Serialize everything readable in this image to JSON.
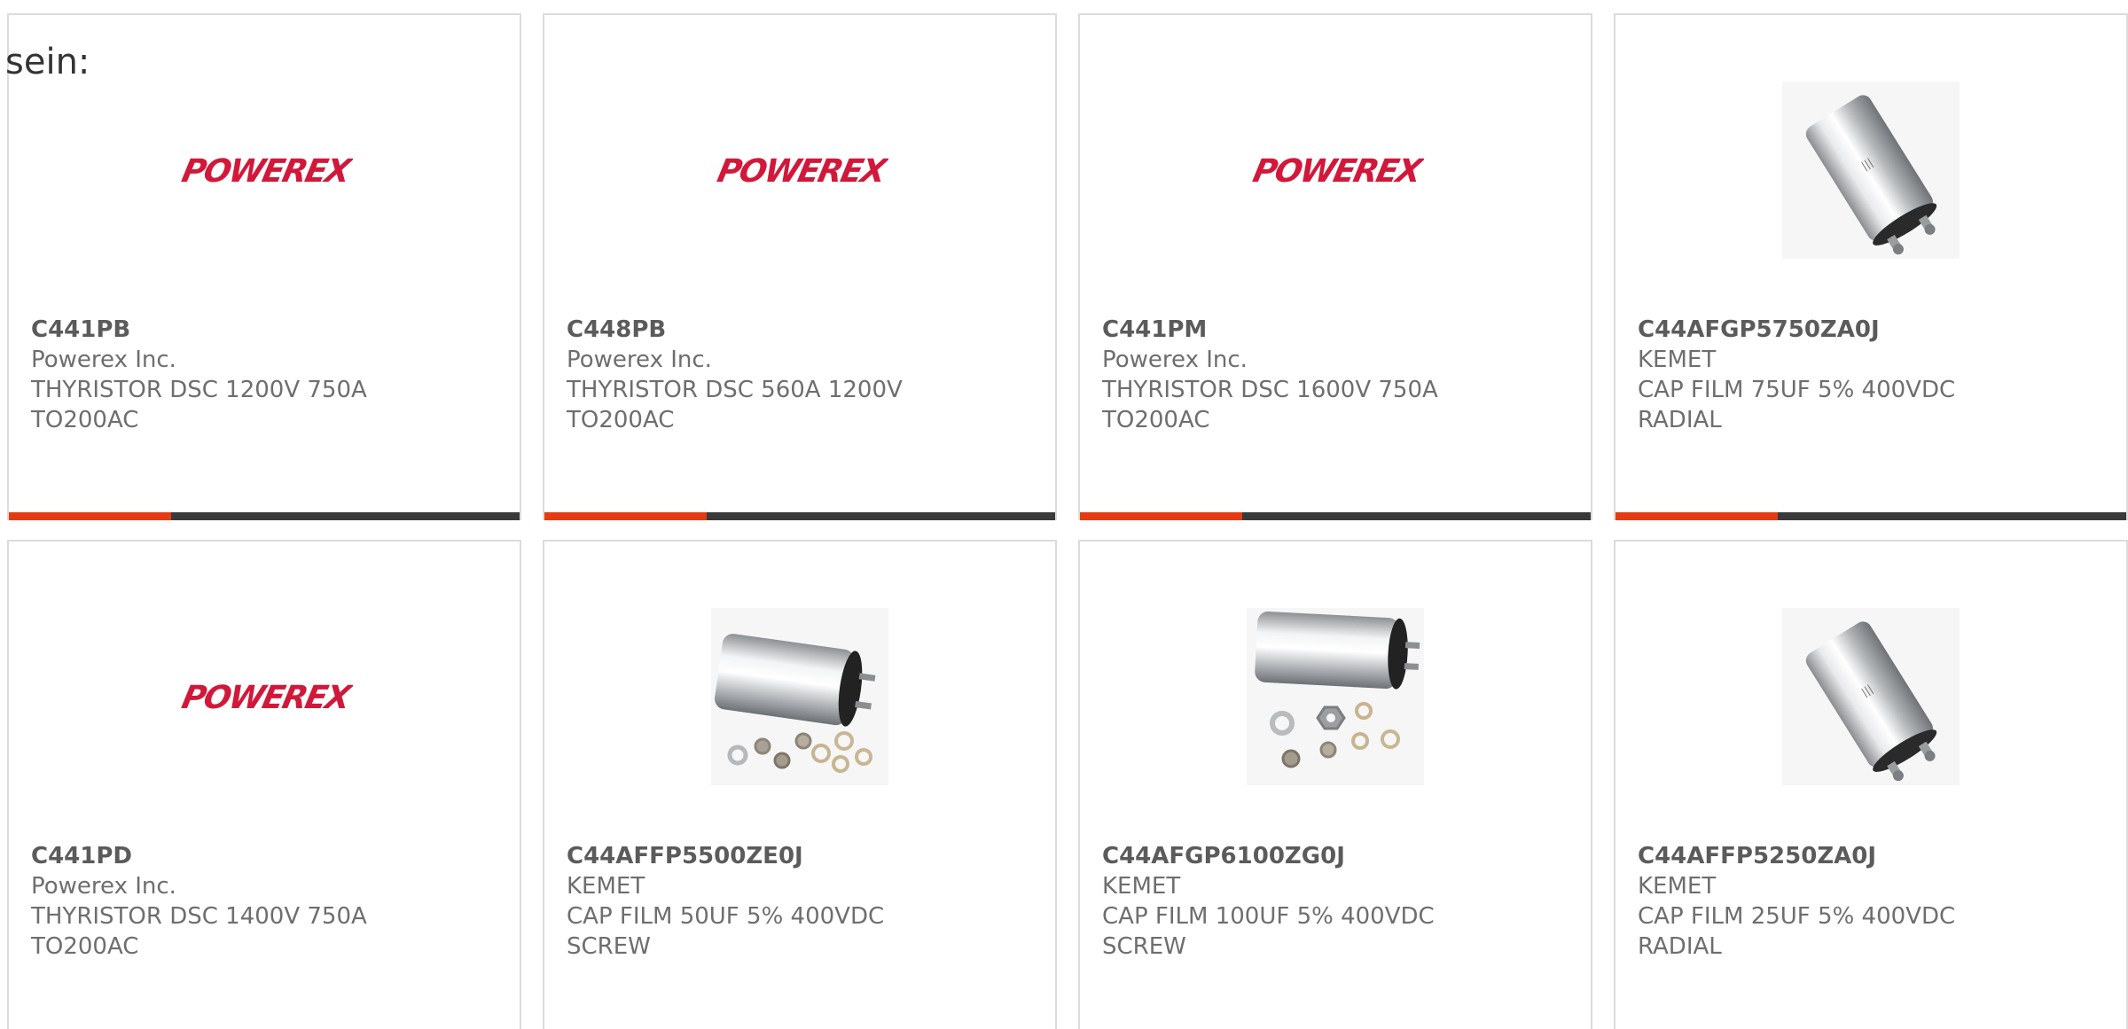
{
  "intro_text": "sein:",
  "colors": {
    "accent_bar": "#e43b12",
    "base_bar": "#3a3a3a",
    "powerex_red": "#d2183a"
  },
  "logo_text": "POWEREX",
  "products": [
    {
      "part_number": "C441PB",
      "manufacturer": "Powerex Inc.",
      "desc_line1": "THYRISTOR DSC 1200V 750A",
      "desc_line2": "TO200AC",
      "image": "powerex-logo"
    },
    {
      "part_number": "C448PB",
      "manufacturer": "Powerex Inc.",
      "desc_line1": "THYRISTOR DSC 560A 1200V",
      "desc_line2": "TO200AC",
      "image": "powerex-logo"
    },
    {
      "part_number": "C441PM",
      "manufacturer": "Powerex Inc.",
      "desc_line1": "THYRISTOR DSC 1600V 750A",
      "desc_line2": "TO200AC",
      "image": "powerex-logo"
    },
    {
      "part_number": "C44AFGP5750ZA0J",
      "manufacturer": "KEMET",
      "desc_line1": "CAP FILM 75UF 5% 400VDC",
      "desc_line2": "RADIAL",
      "image": "capacitor-upright-photo"
    },
    {
      "part_number": "C441PD",
      "manufacturer": "Powerex Inc.",
      "desc_line1": "THYRISTOR DSC 1400V 750A",
      "desc_line2": "TO200AC",
      "image": "powerex-logo"
    },
    {
      "part_number": "C44AFFP5500ZE0J",
      "manufacturer": "KEMET",
      "desc_line1": "CAP FILM 50UF 5% 400VDC",
      "desc_line2": "SCREW",
      "image": "capacitor-horizontal-photo"
    },
    {
      "part_number": "C44AFGP6100ZG0J",
      "manufacturer": "KEMET",
      "desc_line1": "CAP FILM 100UF 5% 400VDC",
      "desc_line2": "SCREW",
      "image": "capacitor-horizontal-photo"
    },
    {
      "part_number": "C44AFFP5250ZA0J",
      "manufacturer": "KEMET",
      "desc_line1": "CAP FILM 25UF 5% 400VDC",
      "desc_line2": "RADIAL",
      "image": "capacitor-upright-photo"
    }
  ]
}
